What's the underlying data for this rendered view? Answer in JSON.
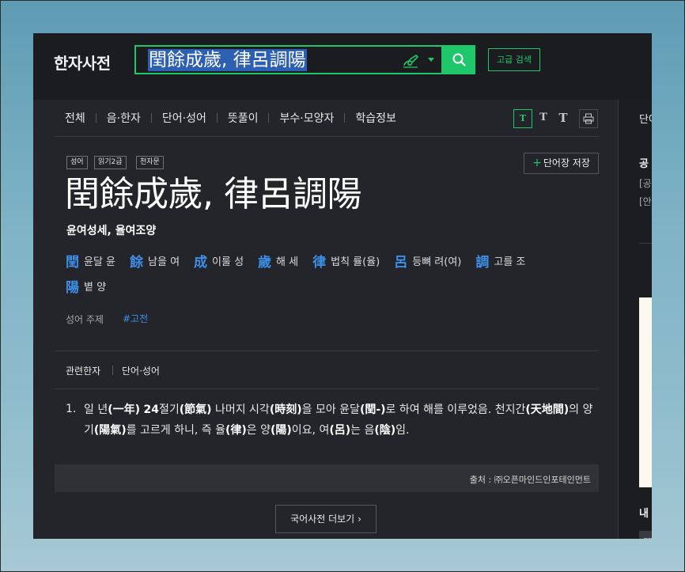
{
  "header": {
    "brand": "한자사전",
    "search_value": "閏餘成歲, 律呂調陽",
    "advanced_search": "고급 검색"
  },
  "menu": {
    "items": [
      "전체",
      "음·한자",
      "단어·성어",
      "뜻풀이",
      "부수·모양자",
      "학습정보"
    ]
  },
  "font_buttons": [
    "T",
    "T",
    "T"
  ],
  "print_icon": "print-icon",
  "entry": {
    "badges": [
      "성어",
      "읽기2급",
      "천자문"
    ],
    "save_label": "단어장 저장",
    "save_plus": "+",
    "headword": "閏餘成歲, 律呂調陽",
    "reading": "윤여성세, 율여조양",
    "hanja": [
      {
        "char": "閏",
        "meaning": "윤달 윤"
      },
      {
        "char": "餘",
        "meaning": "남을 여"
      },
      {
        "char": "成",
        "meaning": "이룰 성"
      },
      {
        "char": "歲",
        "meaning": "해 세"
      },
      {
        "char": "律",
        "meaning": "법칙 률(율)"
      },
      {
        "char": "呂",
        "meaning": "등뼈 려(여)"
      },
      {
        "char": "調",
        "meaning": "고를 조"
      },
      {
        "char": "陽",
        "meaning": "볕 양"
      }
    ],
    "topic_label": "성어 주제",
    "topic_tag": "#고전"
  },
  "related": {
    "tab1": "관련한자",
    "tab2": "단어·성어"
  },
  "definition": {
    "number": "1.",
    "segments": [
      {
        "t": "일 년",
        "b": false
      },
      {
        "t": "(一年)",
        "b": true
      },
      {
        "t": " ",
        "b": false
      },
      {
        "t": "24",
        "b": true
      },
      {
        "t": "절기",
        "b": false
      },
      {
        "t": "(節氣)",
        "b": true
      },
      {
        "t": " 나머지 시각",
        "b": false
      },
      {
        "t": "(時刻)",
        "b": true
      },
      {
        "t": "을 모아 윤달",
        "b": false
      },
      {
        "t": "(閏-)",
        "b": true
      },
      {
        "t": "로 하여 해를 이루었음. 천지간",
        "b": false
      },
      {
        "t": "(天地間)",
        "b": true
      },
      {
        "t": "의 양기",
        "b": false
      },
      {
        "t": "(陽氣)",
        "b": true
      },
      {
        "t": "를 고르게 하니, 즉 율",
        "b": false
      },
      {
        "t": "(律)",
        "b": true
      },
      {
        "t": "은 양",
        "b": false
      },
      {
        "t": "(陽)",
        "b": true
      },
      {
        "t": "이요, 여",
        "b": false
      },
      {
        "t": "(呂)",
        "b": true
      },
      {
        "t": "는 음",
        "b": false
      },
      {
        "t": "(陰)",
        "b": true
      },
      {
        "t": "임.",
        "b": false
      }
    ]
  },
  "source": "출처 : ㈜오픈마인드인포테인먼트",
  "more_button": "국어사전 더보기",
  "more_chevron": "›",
  "right_col": {
    "tab": "단어",
    "title": "공",
    "line1": "[공",
    "line2": "[안",
    "bold": "내",
    "chip": "閏"
  },
  "colors": {
    "accent_green": "#1ec86a",
    "hanja_blue": "#3d8fe8",
    "selection": "#2d5fb3",
    "background": "#24252a"
  }
}
